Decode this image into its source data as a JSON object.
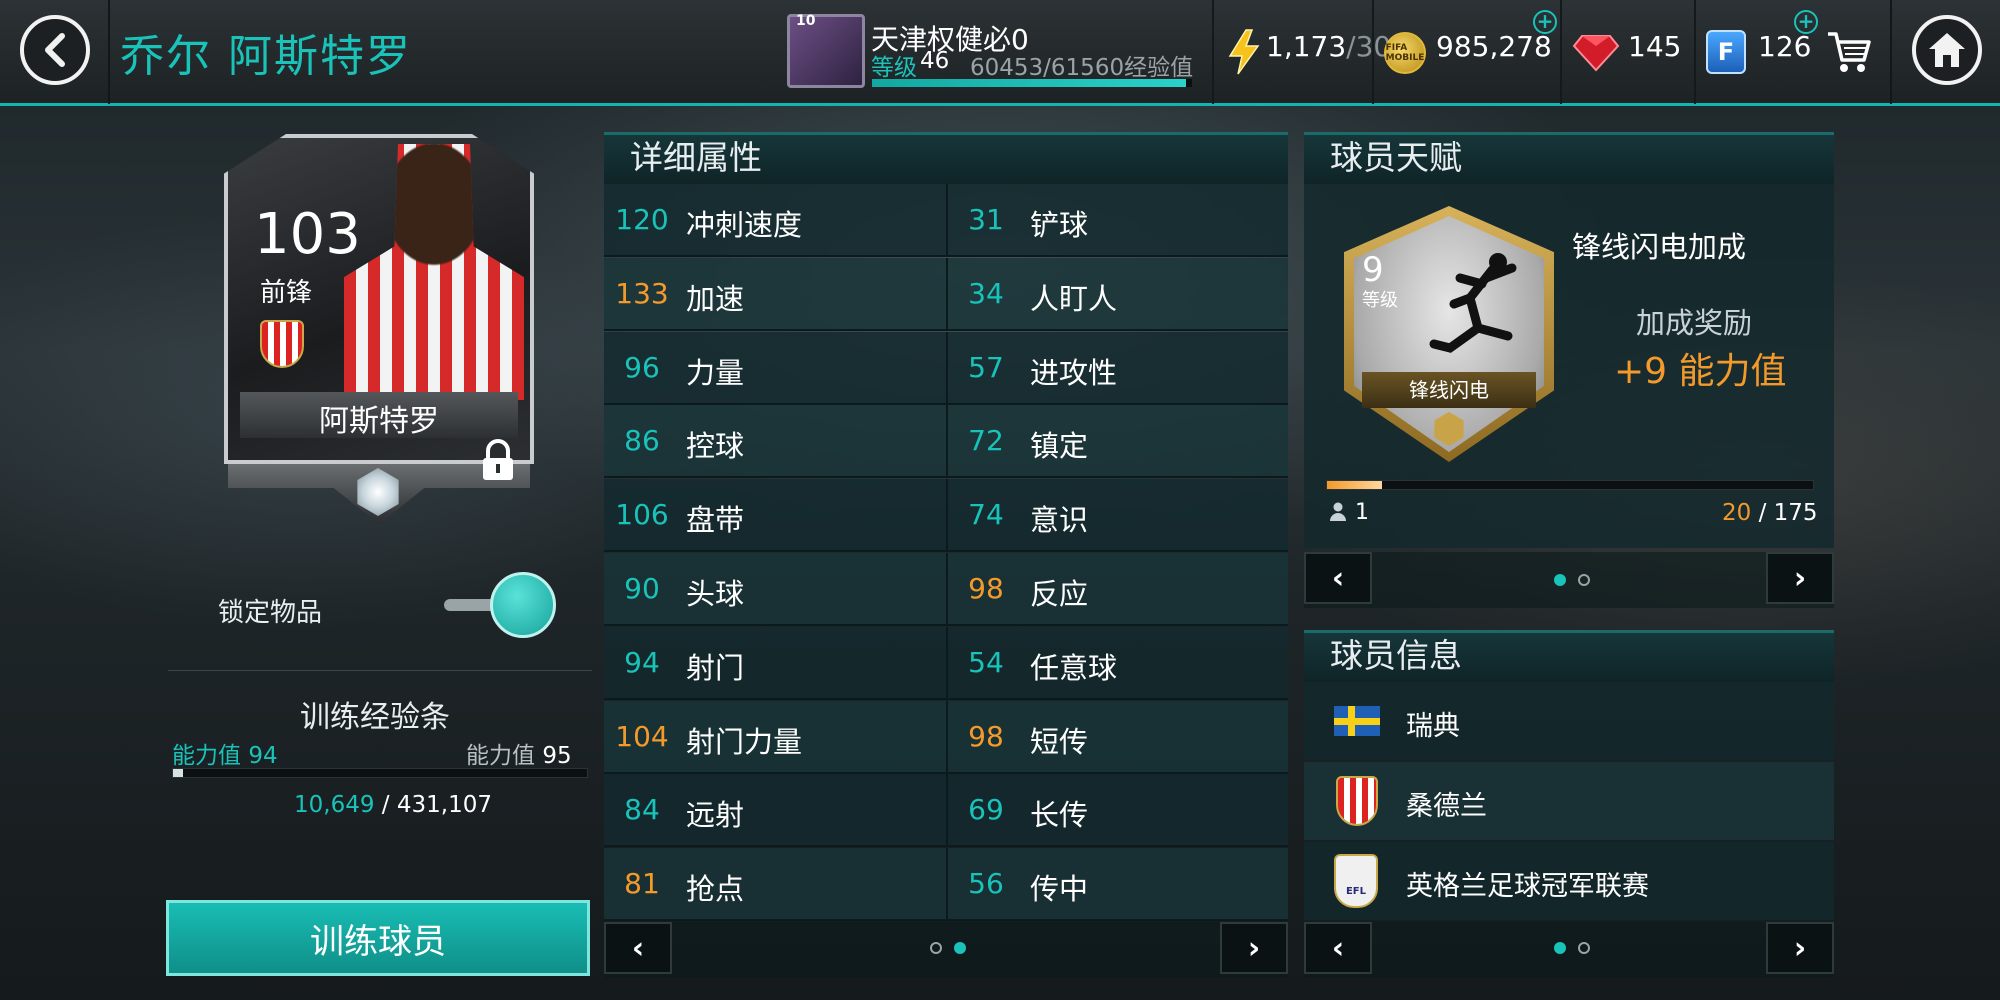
{
  "header": {
    "player_name": "乔尔 阿斯特罗",
    "profile": {
      "badge_level": "10",
      "name": "天津权健必0",
      "level_label": "等级",
      "level_value": "46",
      "exp_text": "60453/61560经验值",
      "exp_progress": 0.982
    },
    "resources": {
      "energy_current": "1,173",
      "energy_max": "/30",
      "coins": "985,278",
      "coin_icon_text": "FIFA MOBILE",
      "gems": "145",
      "fifa_points": "126",
      "fifa_points_icon_text": "F"
    }
  },
  "player_card": {
    "rating": "103",
    "position": "前锋",
    "name": "阿斯特罗"
  },
  "lock": {
    "label": "锁定物品",
    "on": true
  },
  "training": {
    "title": "训练经验条",
    "left_label": "能力值",
    "left_value": "94",
    "right_label": "能力值",
    "right_value": "95",
    "exp_current": "10,649",
    "exp_sep": " / ",
    "exp_total": "431,107",
    "progress": 0.025,
    "button_label": "训练球员"
  },
  "attributes": {
    "title": "详细属性",
    "rows": [
      {
        "lv": "120",
        "ln": "冲刺速度",
        "lc": "teal",
        "rv": "31",
        "rn": "铲球",
        "rc": "teal"
      },
      {
        "lv": "133",
        "ln": "加速",
        "lc": "orange",
        "rv": "34",
        "rn": "人盯人",
        "rc": "teal"
      },
      {
        "lv": "96",
        "ln": "力量",
        "lc": "teal",
        "rv": "57",
        "rn": "进攻性",
        "rc": "teal"
      },
      {
        "lv": "86",
        "ln": "控球",
        "lc": "teal",
        "rv": "72",
        "rn": "镇定",
        "rc": "teal"
      },
      {
        "lv": "106",
        "ln": "盘带",
        "lc": "teal",
        "rv": "74",
        "rn": "意识",
        "rc": "teal"
      },
      {
        "lv": "90",
        "ln": "头球",
        "lc": "teal",
        "rv": "98",
        "rn": "反应",
        "rc": "orange"
      },
      {
        "lv": "94",
        "ln": "射门",
        "lc": "teal",
        "rv": "54",
        "rn": "任意球",
        "rc": "teal"
      },
      {
        "lv": "104",
        "ln": "射门力量",
        "lc": "orange",
        "rv": "98",
        "rn": "短传",
        "rc": "orange"
      },
      {
        "lv": "84",
        "ln": "远射",
        "lc": "teal",
        "rv": "69",
        "rn": "长传",
        "rc": "teal"
      },
      {
        "lv": "81",
        "ln": "抢点",
        "lc": "orange",
        "rv": "56",
        "rn": "传中",
        "rc": "teal"
      }
    ],
    "page": 2,
    "pages": 2
  },
  "talent": {
    "title": "球员天赋",
    "level_num": "9",
    "level_label": "等级",
    "badge_name": "锋线闪电",
    "name": "锋线闪电加成",
    "bonus_label": "加成奖励",
    "bonus_value": "+9 能力值",
    "people": "1",
    "progress_current": "20",
    "progress_sep": " / ",
    "progress_total": "175",
    "progress": 0.114,
    "page": 1,
    "pages": 2
  },
  "info": {
    "title": "球员信息",
    "nation": "瑞典",
    "club": "桑德兰",
    "league": "英格兰足球冠军联赛",
    "league_badge_text": "EFL",
    "page": 1,
    "pages": 2
  },
  "colors": {
    "accent": "#19c3b9",
    "highlight": "#f39a2a"
  },
  "icons": {
    "back": "chevron-left-icon",
    "home": "home-icon",
    "energy": "lightning-icon",
    "coin": "coin-icon",
    "gem": "ruby-icon",
    "points": "fifa-points-icon",
    "cart": "cart-icon",
    "lock": "lock-icon",
    "people": "person-icon"
  }
}
